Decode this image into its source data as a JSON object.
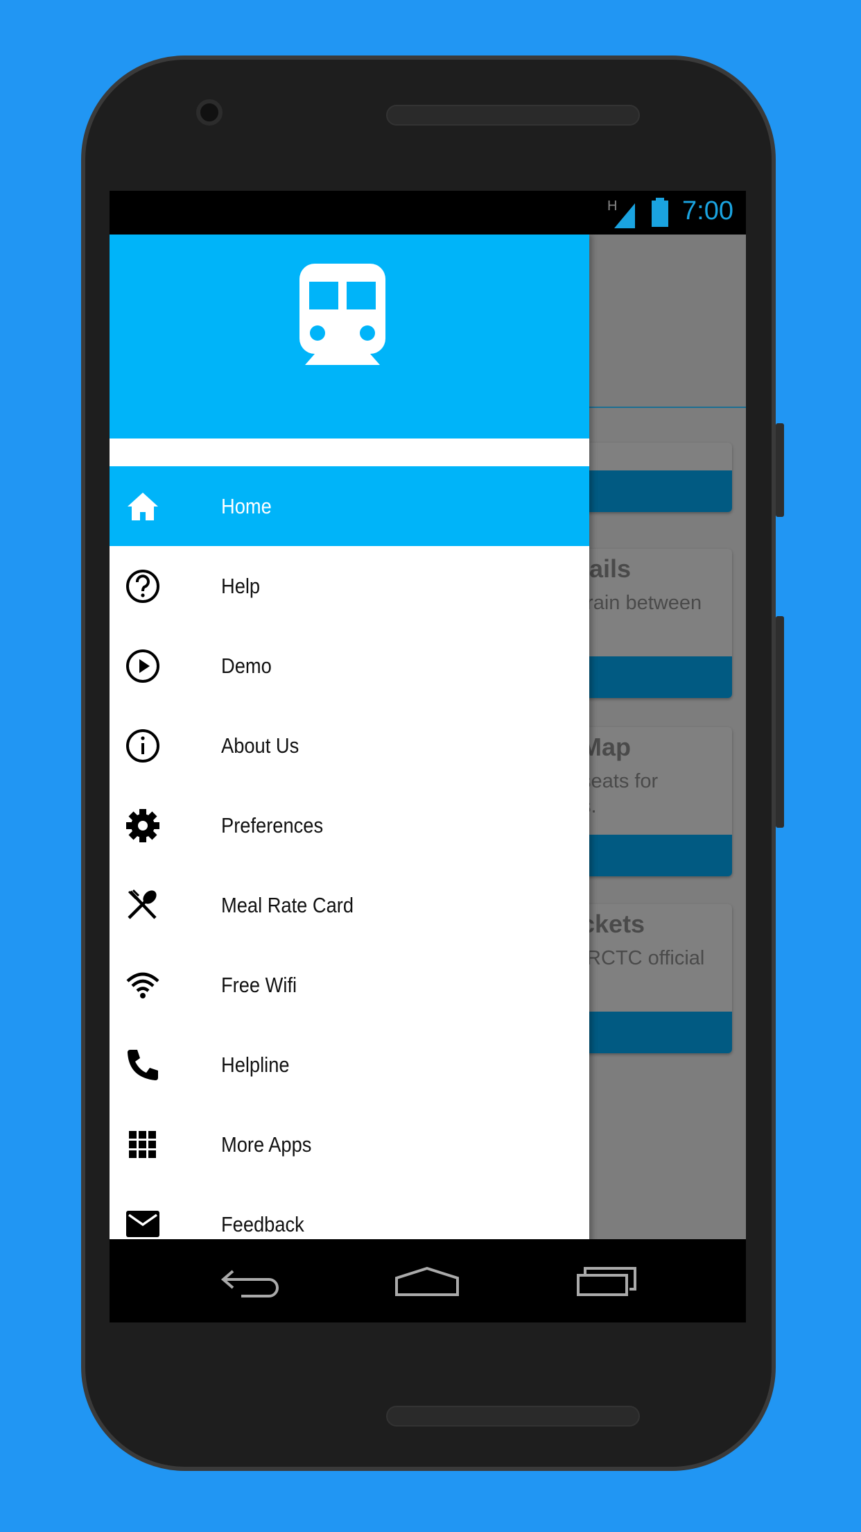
{
  "status_bar": {
    "network": "H",
    "time": "7:00",
    "accent": "#1aa3e0"
  },
  "drawer": {
    "header_icon": "train-icon",
    "header_color": "#00b4f9",
    "items": [
      {
        "label": "Home",
        "icon": "home-icon",
        "active": true
      },
      {
        "label": "Help",
        "icon": "help-circle-icon"
      },
      {
        "label": "Demo",
        "icon": "play-circle-icon"
      },
      {
        "label": "About Us",
        "icon": "info-icon"
      },
      {
        "label": "Preferences",
        "icon": "gear-icon"
      },
      {
        "label": "Meal Rate Card",
        "icon": "fork-spoon-icon"
      },
      {
        "label": "Free Wifi",
        "icon": "wifi-icon"
      },
      {
        "label": "Helpline",
        "icon": "phone-icon"
      },
      {
        "label": "More Apps",
        "icon": "grid-icon"
      },
      {
        "label": "Feedback",
        "icon": "mail-icon"
      }
    ]
  },
  "background_cards": [
    {
      "title": "tails",
      "desc": [
        "train between"
      ]
    },
    {
      "title": "Map",
      "desc": [
        "seats for",
        "s."
      ]
    },
    {
      "title": "ckets",
      "desc": [
        "IRCTC official"
      ]
    }
  ],
  "nav_bar": {
    "back": "back-icon",
    "home": "home-nav-icon",
    "recents": "recents-icon"
  }
}
